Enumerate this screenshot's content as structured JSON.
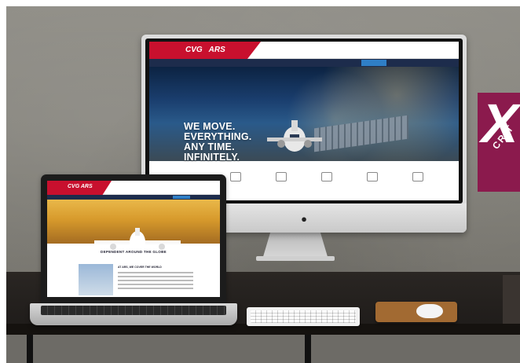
{
  "badge": {
    "mark": "X",
    "text": "CRIT"
  },
  "imac": {
    "site": {
      "brand": "CVG",
      "brand_sub": "ARS",
      "contacts": [
        "",
        "",
        "",
        "",
        ""
      ],
      "nav": [
        "",
        "",
        "",
        "",
        ""
      ],
      "nav_button": "",
      "tagline_lines": [
        "WE MOVE.",
        "EVERYTHING.",
        "ANY TIME.",
        "INFINITELY."
      ],
      "services": [
        {
          "icon": "plane-icon",
          "label": ""
        },
        {
          "icon": "cargo-icon",
          "label": ""
        },
        {
          "icon": "building-icon",
          "label": ""
        },
        {
          "icon": "search-icon",
          "label": ""
        },
        {
          "icon": "document-icon",
          "label": ""
        }
      ]
    }
  },
  "macbook": {
    "site": {
      "brand": "CVG ARS",
      "heading": "DEPENDENT AROUND THE GLOBE",
      "subheading": "AT ARS, WE COVER THE WORLD"
    }
  }
}
